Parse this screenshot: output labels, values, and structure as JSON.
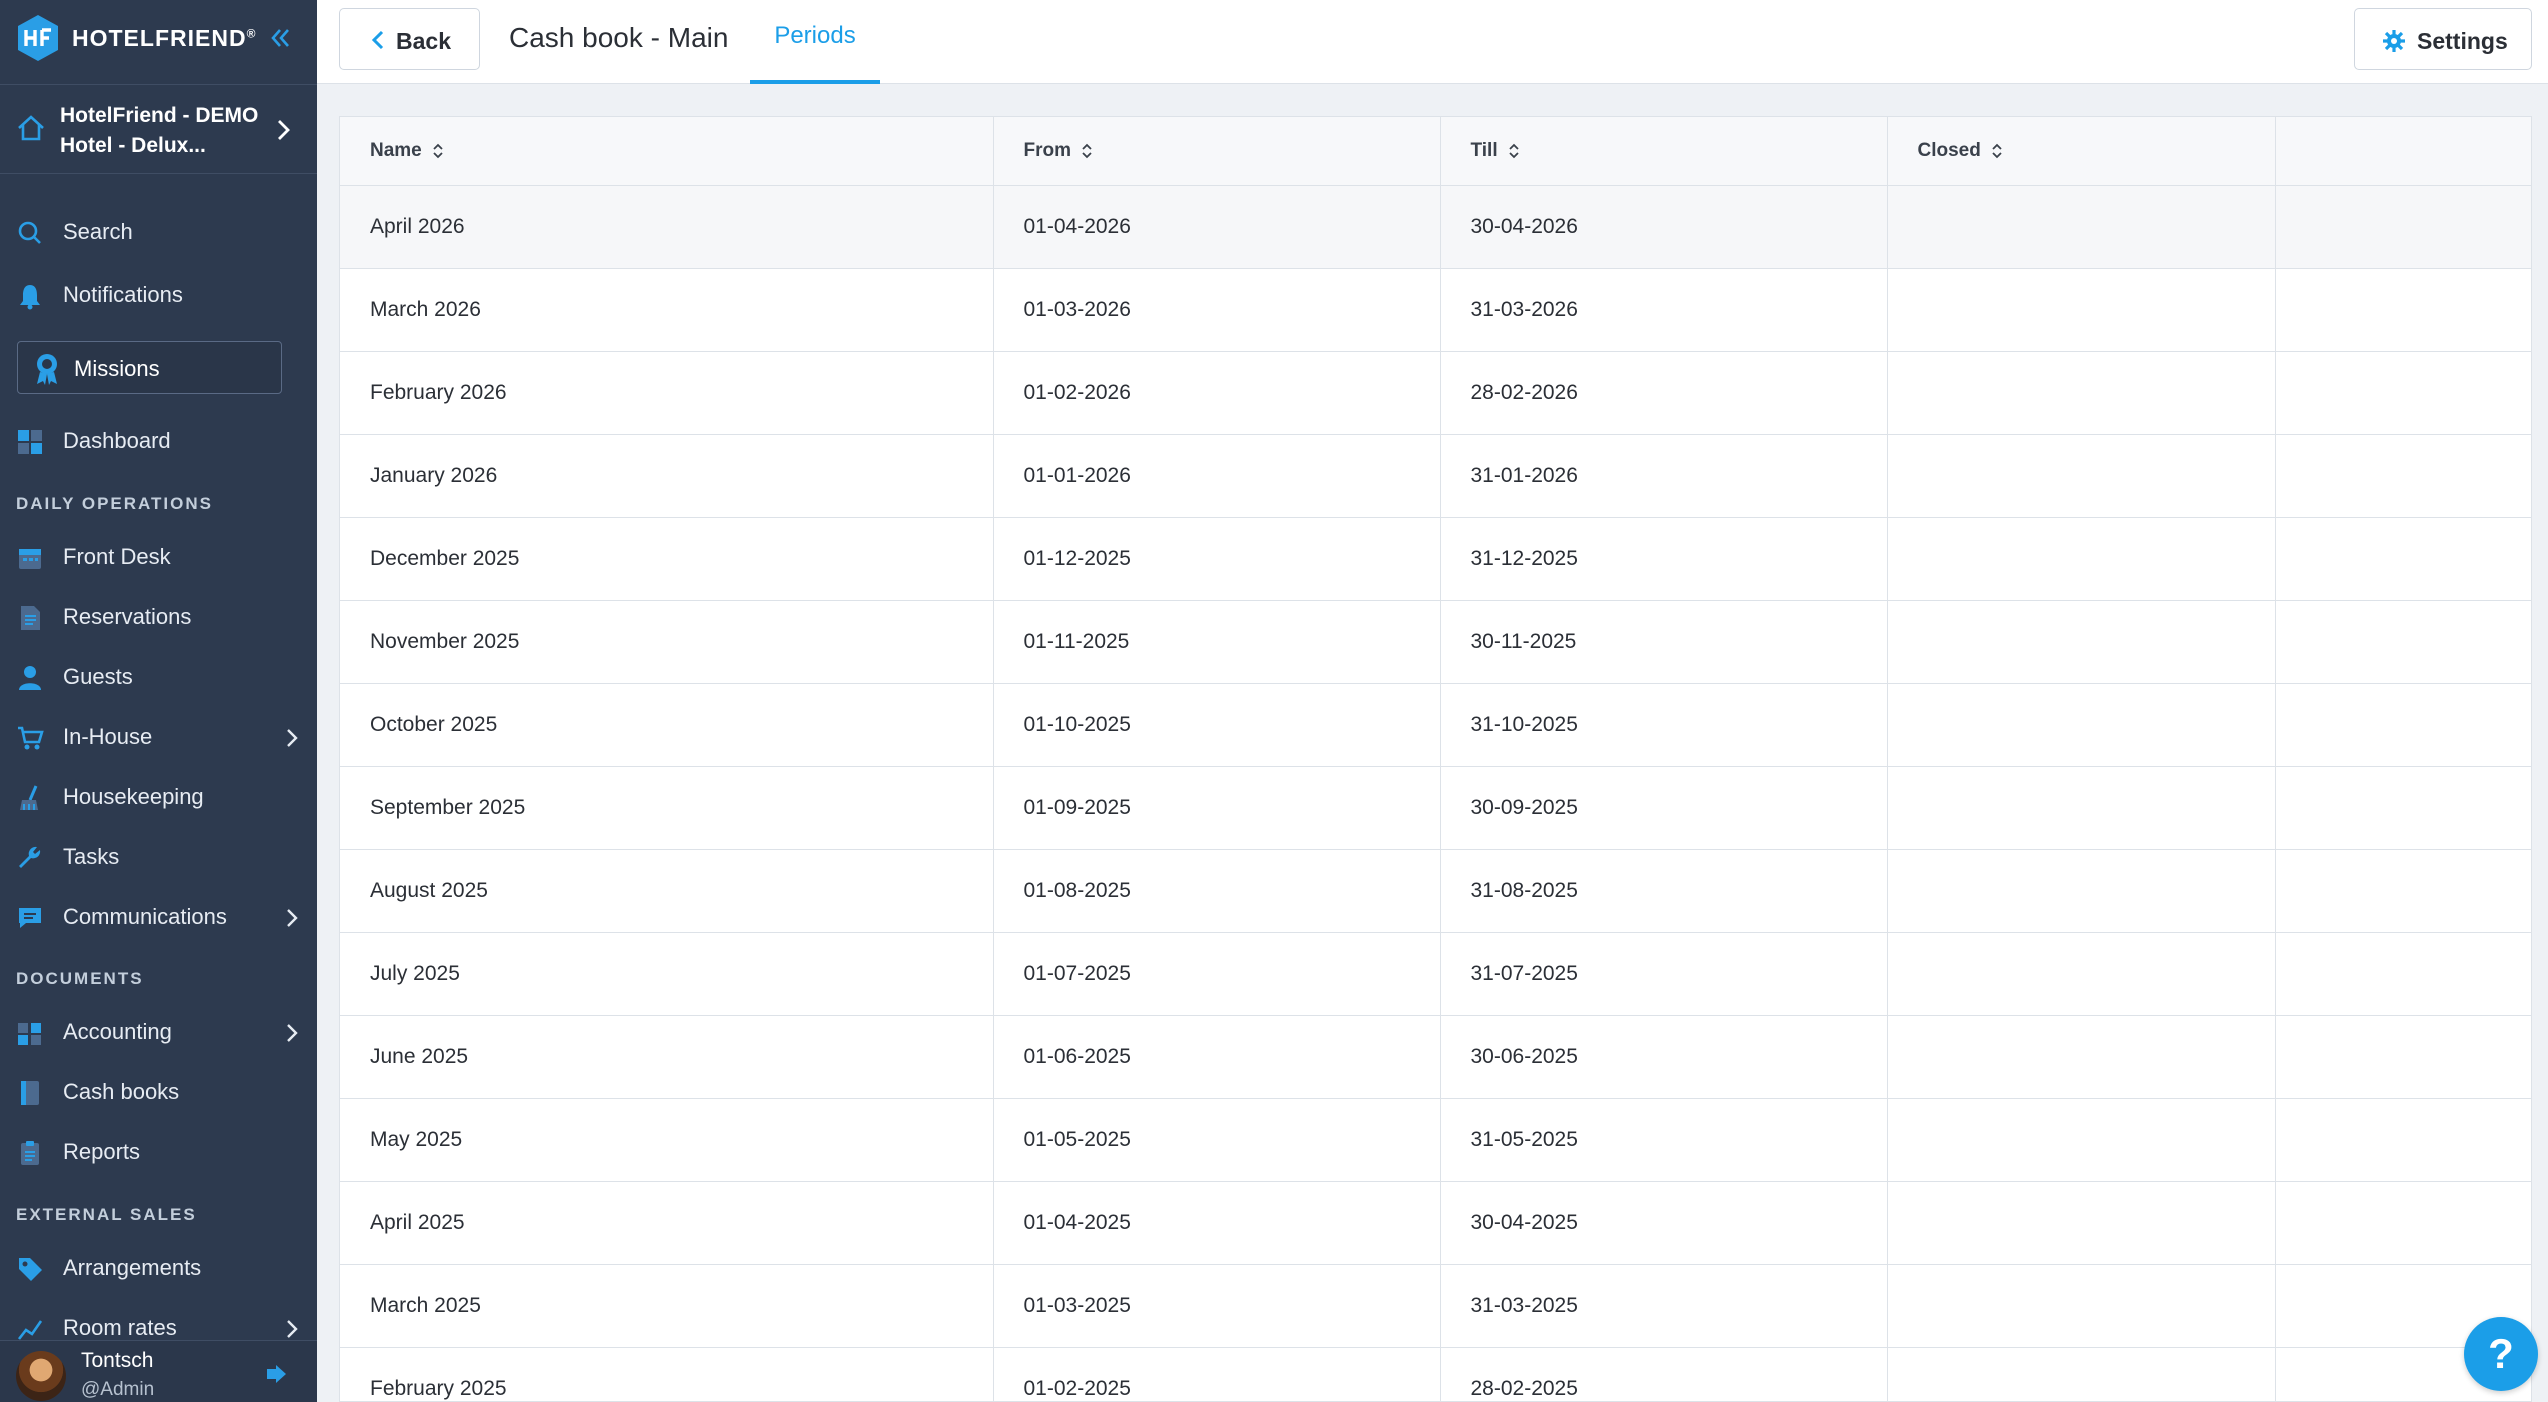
{
  "brand": {
    "name": "HOTELFRIEND",
    "registered": "®"
  },
  "hotel": {
    "name": "HotelFriend - DEMO Hotel - Delux..."
  },
  "nav": {
    "search": "Search",
    "notifications": "Notifications",
    "missions": "Missions",
    "dashboard": "Dashboard",
    "daily_operations": "DAILY OPERATIONS",
    "front_desk": "Front Desk",
    "reservations": "Reservations",
    "guests": "Guests",
    "in_house": "In-House",
    "housekeeping": "Housekeeping",
    "tasks": "Tasks",
    "communications": "Communications",
    "documents": "DOCUMENTS",
    "accounting": "Accounting",
    "cash_books": "Cash books",
    "reports": "Reports",
    "external_sales": "EXTERNAL SALES",
    "arrangements": "Arrangements",
    "room_rates": "Room rates"
  },
  "user": {
    "name": "Tontsch",
    "role": "@Admin"
  },
  "header": {
    "back_label": "Back",
    "title": "Cash book - Main",
    "tab_periods": "Periods",
    "settings_label": "Settings"
  },
  "table": {
    "columns": {
      "name": "Name",
      "from": "From",
      "till": "Till",
      "closed": "Closed"
    },
    "rows": [
      {
        "name": "April 2026",
        "from": "01-04-2026",
        "till": "30-04-2026",
        "closed": ""
      },
      {
        "name": "March 2026",
        "from": "01-03-2026",
        "till": "31-03-2026",
        "closed": ""
      },
      {
        "name": "February 2026",
        "from": "01-02-2026",
        "till": "28-02-2026",
        "closed": ""
      },
      {
        "name": "January 2026",
        "from": "01-01-2026",
        "till": "31-01-2026",
        "closed": ""
      },
      {
        "name": "December 2025",
        "from": "01-12-2025",
        "till": "31-12-2025",
        "closed": ""
      },
      {
        "name": "November 2025",
        "from": "01-11-2025",
        "till": "30-11-2025",
        "closed": ""
      },
      {
        "name": "October 2025",
        "from": "01-10-2025",
        "till": "31-10-2025",
        "closed": ""
      },
      {
        "name": "September 2025",
        "from": "01-09-2025",
        "till": "30-09-2025",
        "closed": ""
      },
      {
        "name": "August 2025",
        "from": "01-08-2025",
        "till": "31-08-2025",
        "closed": ""
      },
      {
        "name": "July 2025",
        "from": "01-07-2025",
        "till": "31-07-2025",
        "closed": ""
      },
      {
        "name": "June 2025",
        "from": "01-06-2025",
        "till": "30-06-2025",
        "closed": ""
      },
      {
        "name": "May 2025",
        "from": "01-05-2025",
        "till": "31-05-2025",
        "closed": ""
      },
      {
        "name": "April 2025",
        "from": "01-04-2025",
        "till": "30-04-2025",
        "closed": ""
      },
      {
        "name": "March 2025",
        "from": "01-03-2025",
        "till": "31-03-2025",
        "closed": ""
      },
      {
        "name": "February 2025",
        "from": "01-02-2025",
        "till": "28-02-2025",
        "closed": ""
      }
    ]
  },
  "help": {
    "label": "?"
  },
  "colors": {
    "sidebar_bg": "#2d3a4f",
    "accent": "#1b9ee8",
    "icon": "#2a9ee6"
  }
}
